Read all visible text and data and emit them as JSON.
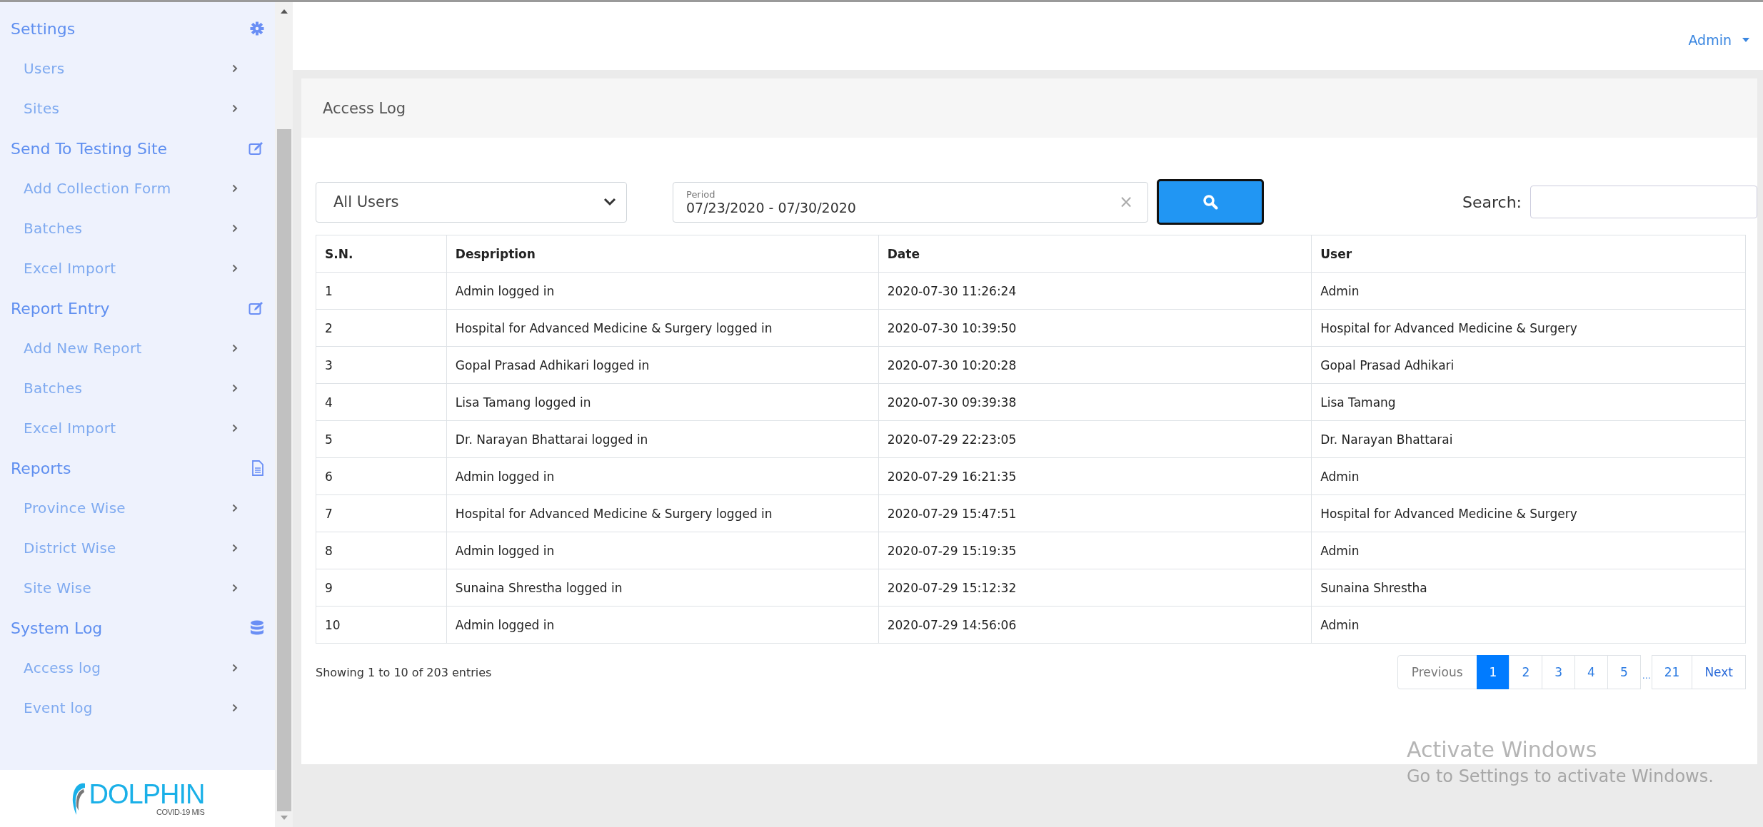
{
  "sidebar": {
    "groups": [
      {
        "label": "Settings",
        "items": [
          "Users",
          "Sites"
        ]
      },
      {
        "label": "Send To Testing Site",
        "items": [
          "Add Collection Form",
          "Batches",
          "Excel Import"
        ]
      },
      {
        "label": "Report Entry",
        "items": [
          "Add New Report",
          "Batches",
          "Excel Import"
        ]
      },
      {
        "label": "Reports",
        "items": [
          "Province Wise",
          "District Wise",
          "Site Wise"
        ]
      },
      {
        "label": "System Log",
        "items": [
          "Access log",
          "Event log"
        ]
      }
    ],
    "logo": {
      "name": "DOLPHIN",
      "tagline": "COVID-19 MIS"
    }
  },
  "topbar": {
    "user_menu": "Admin"
  },
  "page": {
    "title": "Access Log",
    "filters": {
      "user_select": "All Users",
      "period_label": "Period",
      "period_value": "07/23/2020 - 07/30/2020",
      "clear": "×",
      "search_label": "Search:"
    },
    "table": {
      "columns": [
        "S.N.",
        "Despription",
        "Date",
        "User"
      ],
      "rows": [
        [
          "1",
          "Admin logged in",
          "2020-07-30 11:26:24",
          "Admin"
        ],
        [
          "2",
          "Hospital for Advanced Medicine & Surgery logged in",
          "2020-07-30 10:39:50",
          "Hospital for Advanced Medicine & Surgery"
        ],
        [
          "3",
          "Gopal Prasad Adhikari logged in",
          "2020-07-30 10:20:28",
          "Gopal Prasad Adhikari"
        ],
        [
          "4",
          "Lisa Tamang logged in",
          "2020-07-30 09:39:38",
          "Lisa Tamang"
        ],
        [
          "5",
          "Dr. Narayan Bhattarai logged in",
          "2020-07-29 22:23:05",
          "Dr. Narayan Bhattarai"
        ],
        [
          "6",
          "Admin logged in",
          "2020-07-29 16:21:35",
          "Admin"
        ],
        [
          "7",
          "Hospital for Advanced Medicine & Surgery logged in",
          "2020-07-29 15:47:51",
          "Hospital for Advanced Medicine & Surgery"
        ],
        [
          "8",
          "Admin logged in",
          "2020-07-29 15:19:35",
          "Admin"
        ],
        [
          "9",
          "Sunaina Shrestha logged in",
          "2020-07-29 15:12:32",
          "Sunaina Shrestha"
        ],
        [
          "10",
          "Admin logged in",
          "2020-07-29 14:56:06",
          "Admin"
        ]
      ]
    },
    "info": "Showing 1 to 10 of 203 entries",
    "pagination": [
      {
        "label": "Previous",
        "kind": "nav",
        "selected": false
      },
      {
        "label": "1",
        "kind": "page",
        "selected": true
      },
      {
        "label": "2",
        "kind": "page",
        "selected": false
      },
      {
        "label": "3",
        "kind": "page",
        "selected": false
      },
      {
        "label": "4",
        "kind": "page",
        "selected": false
      },
      {
        "label": "5",
        "kind": "page",
        "selected": false
      },
      {
        "label": "…",
        "kind": "gap"
      },
      {
        "label": "21",
        "kind": "page",
        "selected": false
      },
      {
        "label": "Next",
        "kind": "nav",
        "selected": false
      }
    ]
  },
  "os_notice": {
    "title": "Activate Windows",
    "message": "Go to Settings to activate Windows."
  }
}
